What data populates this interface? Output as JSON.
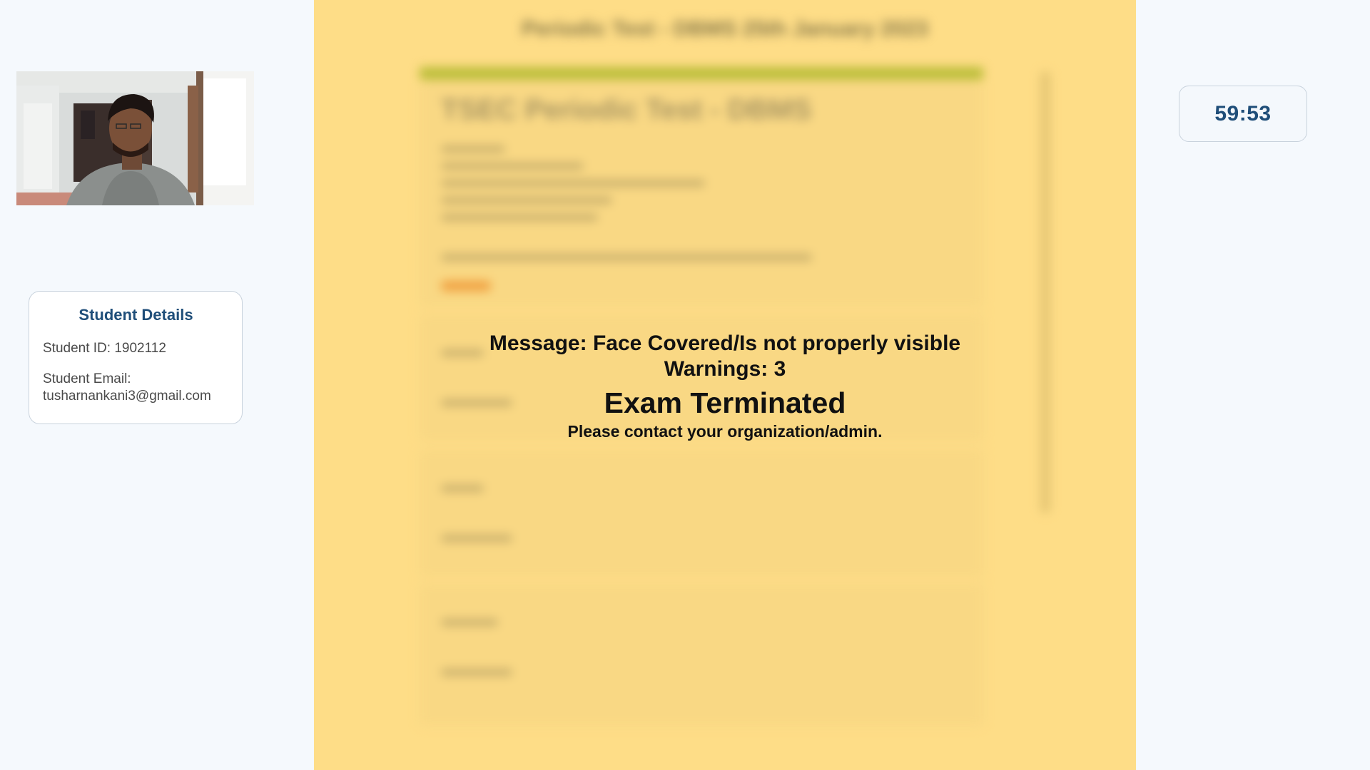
{
  "student_details": {
    "title": "Student Details",
    "id_label": "Student ID:",
    "id_value": "1902112",
    "email_label": "Student Email:",
    "email_value": "tusharnankani3@gmail.com"
  },
  "timer": {
    "value": "59:53"
  },
  "exam": {
    "blurred_title": "Periodic Test - DBMS 25th January 2023",
    "blurred_form_title": "TSEC Periodic Test - DBMS"
  },
  "termination": {
    "message": "Message: Face Covered/Is not properly visible",
    "warnings": "Warnings: 3",
    "status": "Exam Terminated",
    "instruction": "Please contact your organization/admin."
  },
  "colors": {
    "background": "#f5f9fd",
    "exam_overlay": "#fedd87",
    "accent": "#1f4e79"
  },
  "icons": {
    "webcam": "webcam-feed"
  }
}
